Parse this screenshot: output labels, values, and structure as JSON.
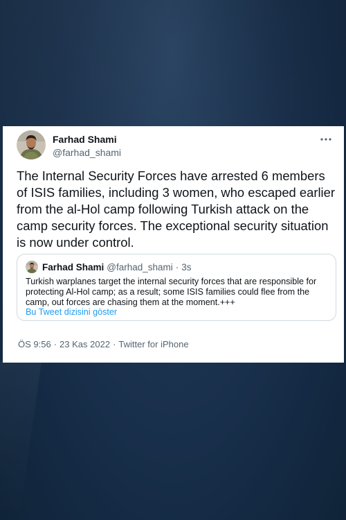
{
  "tweet": {
    "author": {
      "name": "Farhad Shami",
      "handle": "@farhad_shami"
    },
    "more_label": "More",
    "text": "The Internal Security Forces have arrested 6 members of ISIS families, including 3 women, who escaped earlier from the al-Hol camp following Turkish attack on the camp security forces. The exceptional security situation is now under control.",
    "quoted": {
      "name": "Farhad Shami",
      "handle": "@farhad_shami",
      "dot": "·",
      "time": "3s",
      "text": "Turkish warplanes target the internal security forces that are responsible for protecting Al-Hol camp; as a result; some ISIS families could flee from the camp, out forces are chasing them at the moment.+++",
      "thread_link": "Bu Tweet dizisini göster"
    },
    "meta": {
      "time": "ÖS 9:56",
      "sep1": "·",
      "date": "23 Kas 2022",
      "sep2": "·",
      "source": "Twitter for iPhone"
    }
  },
  "colors": {
    "background": "#1c3350",
    "card": "#ffffff",
    "text_primary": "#0f1419",
    "text_secondary": "#536471",
    "link": "#1d9bf0",
    "border": "#cfd9de"
  },
  "icons": {
    "avatar": "profile-photo",
    "more": "more-horizontal-icon"
  }
}
